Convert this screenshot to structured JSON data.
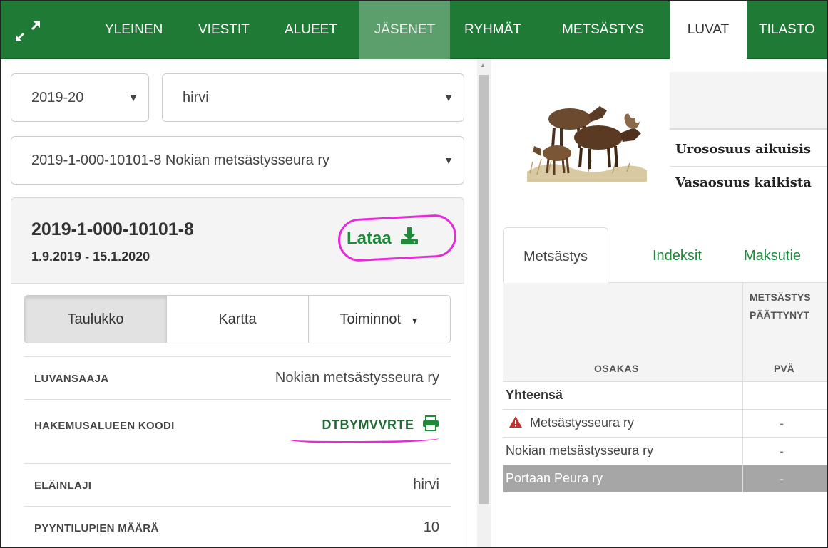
{
  "nav": {
    "items": [
      "YLEINEN",
      "VIESTIT",
      "ALUEET",
      "JÄSENET",
      "RYHMÄT",
      "METSÄSTYS",
      "LUVAT",
      "TILASTO"
    ]
  },
  "filters": {
    "season": "2019-20",
    "species": "hirvi",
    "permit": "2019-1-000-10101-8 Nokian metsästysseura ry"
  },
  "permit": {
    "number": "2019-1-000-10101-8",
    "dates": "1.9.2019 - 15.1.2020",
    "download_label": "Lataa",
    "views": [
      "Taulukko",
      "Kartta",
      "Toiminnot"
    ],
    "details": [
      {
        "label": "LUVANSAAJA",
        "value": "Nokian metsästysseura ry"
      },
      {
        "label": "HAKEMUSALUEEN KOODI",
        "value": "DTBYMVVRTE"
      },
      {
        "label": "ELÄINLAJI",
        "value": "hirvi"
      },
      {
        "label": "PYYNTILUPIEN MÄÄRÄ",
        "value": "10"
      }
    ]
  },
  "summary": {
    "line1": "Urososuus aikuisis",
    "line2": "Vasaosuus kaikista"
  },
  "tabs": [
    "Metsästys",
    "Indeksit",
    "Maksutie"
  ],
  "table": {
    "header_top": [
      "METSÄSTYS",
      "PÄÄTTYNYT"
    ],
    "col_osakas": "OSAKAS",
    "col_pva": "PVÄ",
    "rows": [
      {
        "name": "Yhteensä",
        "value": ""
      },
      {
        "name": "Metsästysseura ry",
        "value": "-"
      },
      {
        "name": "Nokian metsästysseura ry",
        "value": "-"
      },
      {
        "name": "Portaan Peura ry",
        "value": "-"
      }
    ]
  },
  "colors": {
    "nav_green": "#1e7a35",
    "link_green": "#1f8a3a",
    "annotation_magenta": "#e62ad8",
    "warning_red": "#c9302c"
  }
}
